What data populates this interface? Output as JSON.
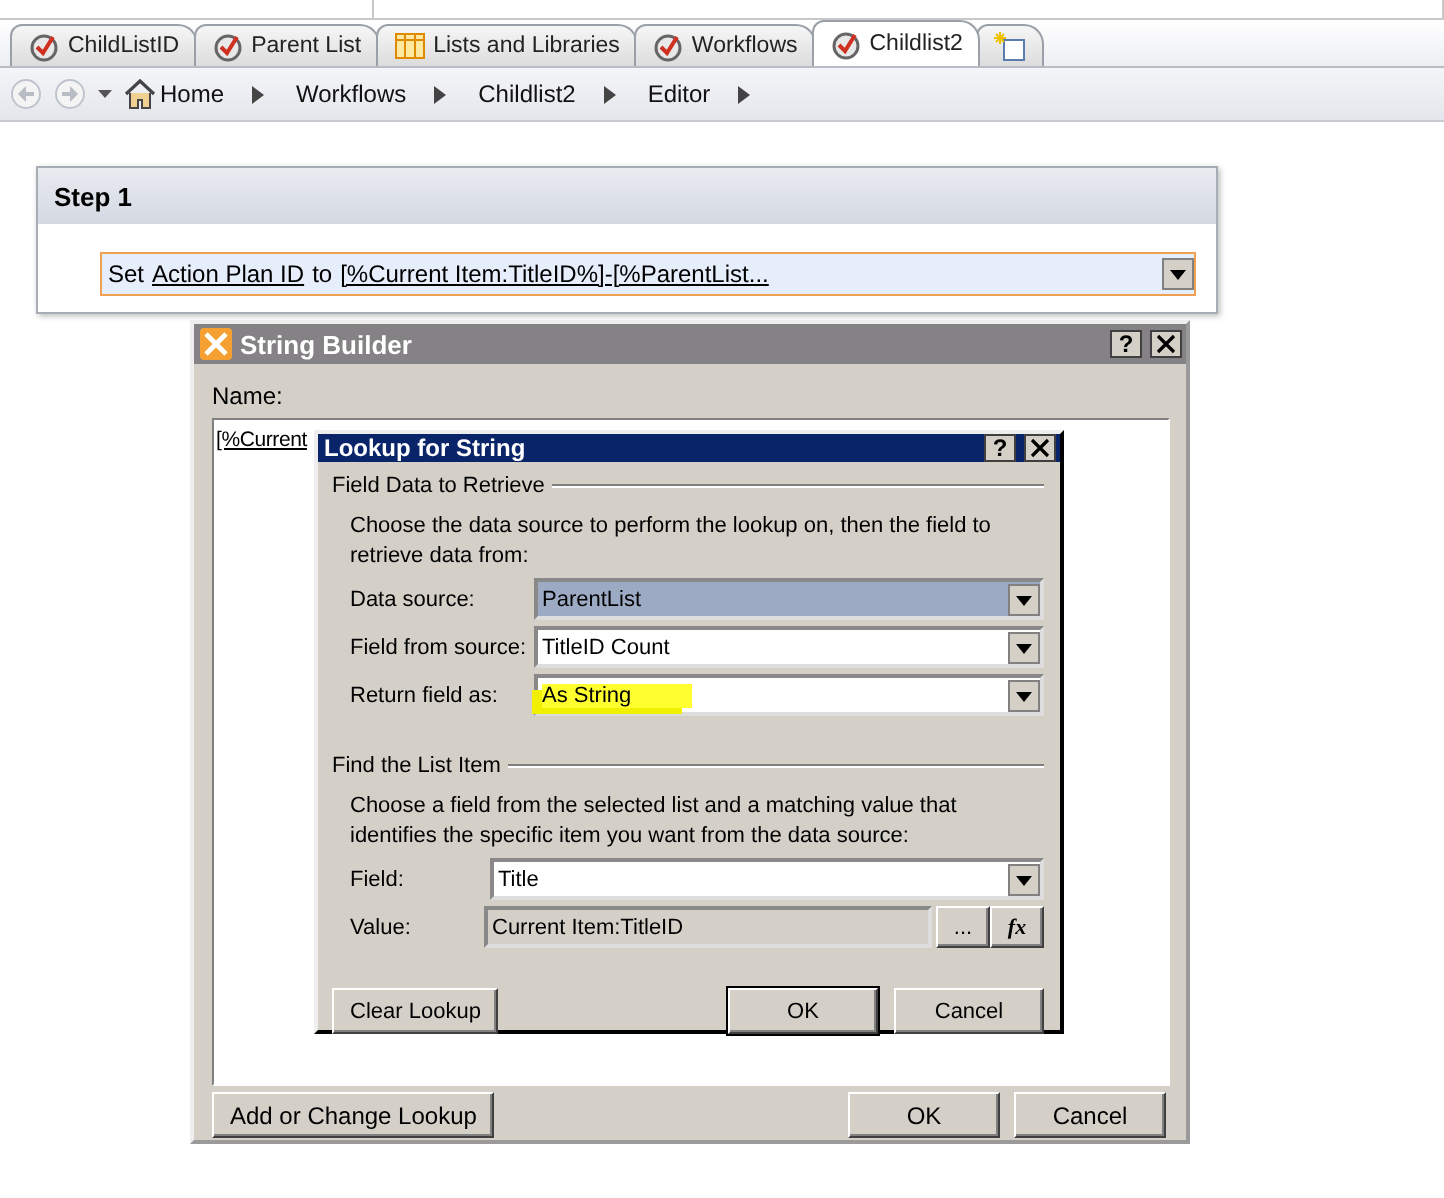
{
  "tabs": [
    {
      "label": "ChildListID",
      "kind": "workflow",
      "selected": false
    },
    {
      "label": "Parent List",
      "kind": "workflow",
      "selected": false
    },
    {
      "label": "Lists and Libraries",
      "kind": "list",
      "selected": false
    },
    {
      "label": "Workflows",
      "kind": "workflow",
      "selected": false
    },
    {
      "label": "Childlist2",
      "kind": "workflow",
      "selected": true
    }
  ],
  "breadcrumb": [
    "Home",
    "Workflows",
    "Childlist2",
    "Editor"
  ],
  "step": {
    "title": "Step 1",
    "action": [
      {
        "text": "Set",
        "link": false
      },
      {
        "text": "Action Plan ID",
        "link": true
      },
      {
        "text": "to",
        "link": false
      },
      {
        "text": "[%Current Item:TitleID%]-[%ParentList...",
        "link": true
      }
    ]
  },
  "string_builder": {
    "title": "String Builder",
    "help": "?",
    "name_label": "Name:",
    "name_value": "[%Current",
    "buttons": [
      "Add or Change Lookup",
      "OK",
      "Cancel"
    ]
  },
  "lookup": {
    "title": "Lookup for String",
    "help": "?",
    "sections": [
      {
        "heading": "Field Data to Retrieve",
        "description": "Choose the data source to perform the lookup on, then the field to retrieve data from:",
        "fields": [
          {
            "label": "Data source:",
            "value": "ParentList",
            "kind": "dropdown",
            "selected": true,
            "highlighted": false
          },
          {
            "label": "Field from source:",
            "value": "TitleID Count",
            "kind": "dropdown",
            "selected": false,
            "highlighted": false
          },
          {
            "label": "Return field as:",
            "value": "As String",
            "kind": "dropdown",
            "selected": false,
            "highlighted": true
          }
        ]
      },
      {
        "heading": "Find the List Item",
        "description": "Choose a field from the selected list and a matching value that identifies the specific item you want from the data source:",
        "fields": [
          {
            "label": "Field:",
            "value": "Title",
            "kind": "dropdown",
            "selected": false,
            "highlighted": false
          },
          {
            "label": "Value:",
            "value": "Current Item:TitleID",
            "kind": "expression",
            "selected": false,
            "highlighted": false,
            "buttons": [
              "...",
              "fx"
            ]
          }
        ]
      }
    ],
    "buttons": [
      "Clear Lookup",
      "OK",
      "Cancel"
    ]
  }
}
